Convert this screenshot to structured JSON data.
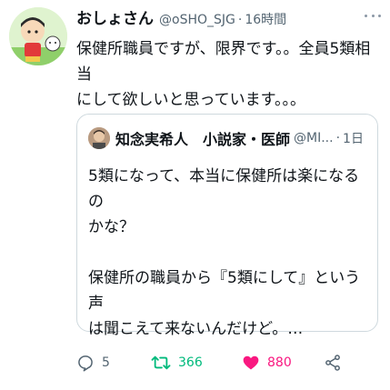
{
  "tweet": {
    "display_name": "おしょさん",
    "handle": "@oSHO_SJG",
    "separator": "·",
    "time": "16時間",
    "text_line1": "保健所職員ですが、限界です。。全員5類相当",
    "text_line2": "にして欲しいと思っています。。。"
  },
  "quote": {
    "display_name": "知念実希人　小説家・医師",
    "handle": "@MI...",
    "separator": "·",
    "time": "1日",
    "body_line1": "5類になって、本当に保健所は楽になるの",
    "body_line2": "かな？",
    "body_line3": "保健所の職員から『5類にして』という声",
    "body_line4": "は聞こえて来ないんだけど。…"
  },
  "actions": {
    "reply_count": "5",
    "retweet_count": "366",
    "like_count": "880"
  },
  "colors": {
    "retweet_active": "#00ba7c",
    "like_active": "#f91880",
    "secondary_text": "#536471",
    "border": "#cfd9de"
  },
  "icons": [
    "avatar",
    "more-icon",
    "reply-icon",
    "retweet-icon",
    "heart-icon",
    "share-icon"
  ]
}
